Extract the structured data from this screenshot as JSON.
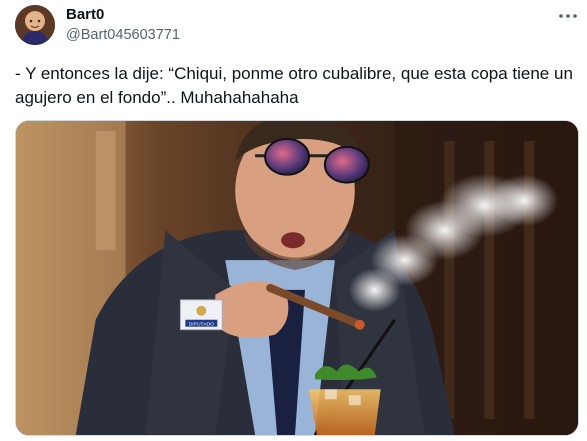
{
  "author": {
    "name": "Bart0",
    "handle": "@Bart045603771",
    "avatar_icon": "avatar-photo"
  },
  "tweet": {
    "text": "- Y entonces la dije: “Chiqui, ponme otro cubalibre, que esta copa tiene un agujero en el fondo”.. Muhahahahaha"
  },
  "more_icon": "more-dots-icon",
  "media": {
    "badge_text": "DIPUTADO",
    "description_icon": "photo-man-with-sunglasses-smoking-cigar"
  },
  "colors": {
    "text_primary": "#0f1419",
    "text_secondary": "#536471",
    "border": "#cfd9de"
  }
}
